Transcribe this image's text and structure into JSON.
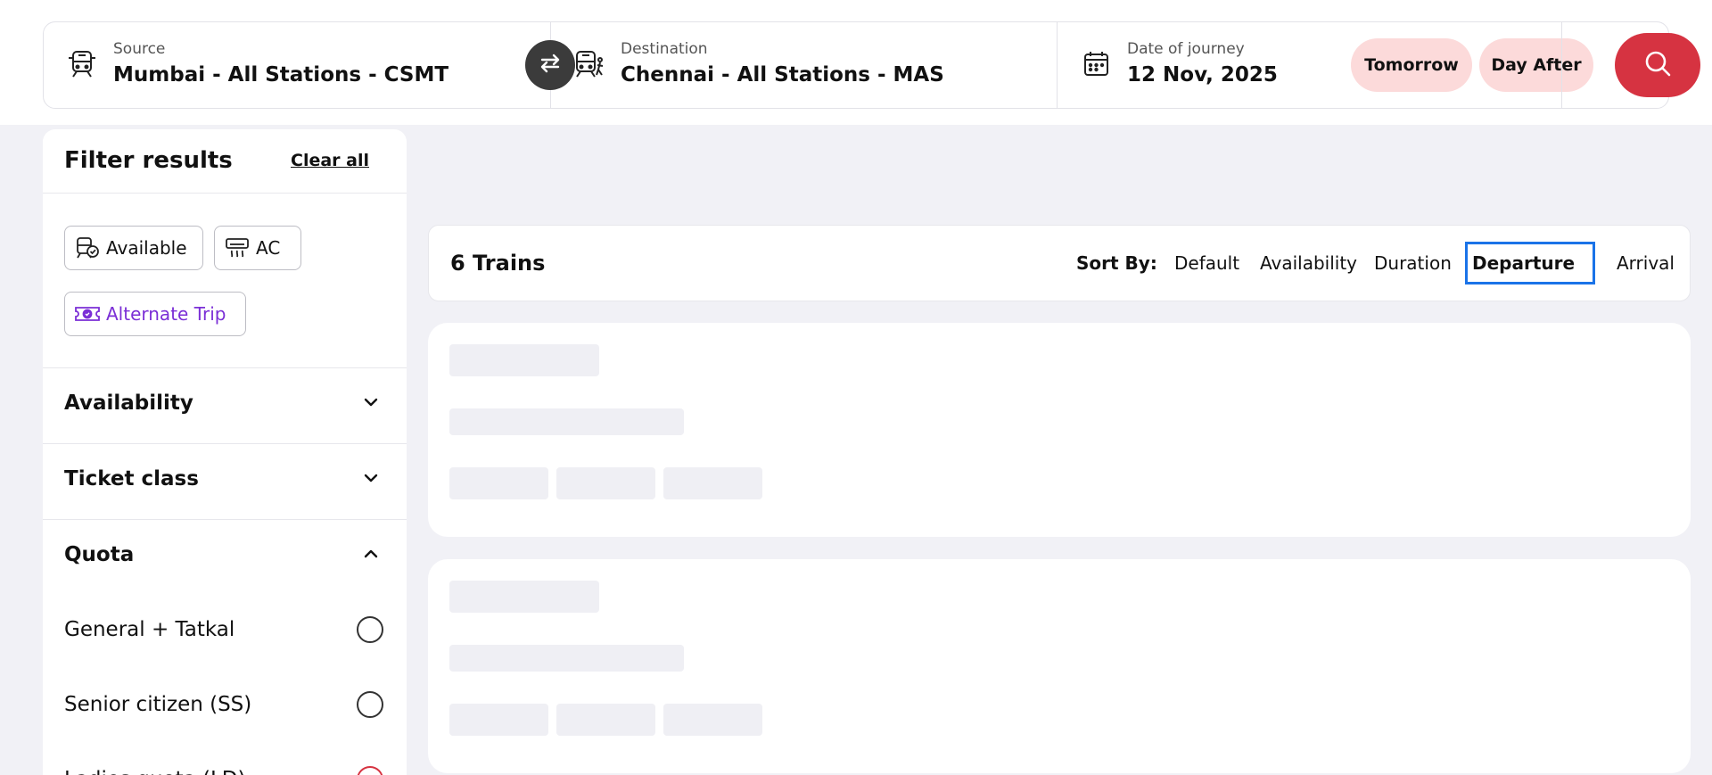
{
  "search": {
    "source_label": "Source",
    "source_value": "Mumbai - All Stations - CSMT",
    "destination_label": "Destination",
    "destination_value": "Chennai - All Stations - MAS",
    "date_label": "Date of journey",
    "date_value": "12 Nov, 2025",
    "quick_dates": [
      "Tomorrow",
      "Day After"
    ],
    "icons": {
      "source": "train-icon",
      "destination": "train-arrive-icon",
      "swap": "swap-icon",
      "date": "calendar-icon",
      "search": "search-icon"
    },
    "colors": {
      "accent": "#d63341",
      "chip_bg": "#fcdada",
      "swap_bg": "#3b3b3b"
    }
  },
  "filters": {
    "title": "Filter results",
    "clear_all": "Clear all",
    "chips": [
      {
        "label": "Available",
        "icon": "available-train-icon"
      },
      {
        "label": "AC",
        "icon": "ac-icon"
      },
      {
        "label": "Alternate Trip",
        "icon": "ticket-icon",
        "color": "#7b2fd6"
      }
    ],
    "sections": [
      {
        "title": "Availability",
        "expanded": false
      },
      {
        "title": "Ticket class",
        "expanded": false
      },
      {
        "title": "Quota",
        "expanded": true
      }
    ],
    "quota_options": [
      "General + Tatkal",
      "Senior citizen (SS)",
      "Ladies quota (LD)"
    ]
  },
  "results": {
    "count_text": "6 Trains",
    "sort_label": "Sort By:",
    "sort_options": [
      "Default",
      "Availability",
      "Duration",
      "Departure",
      "Arrival"
    ],
    "sort_selected": "Departure"
  }
}
